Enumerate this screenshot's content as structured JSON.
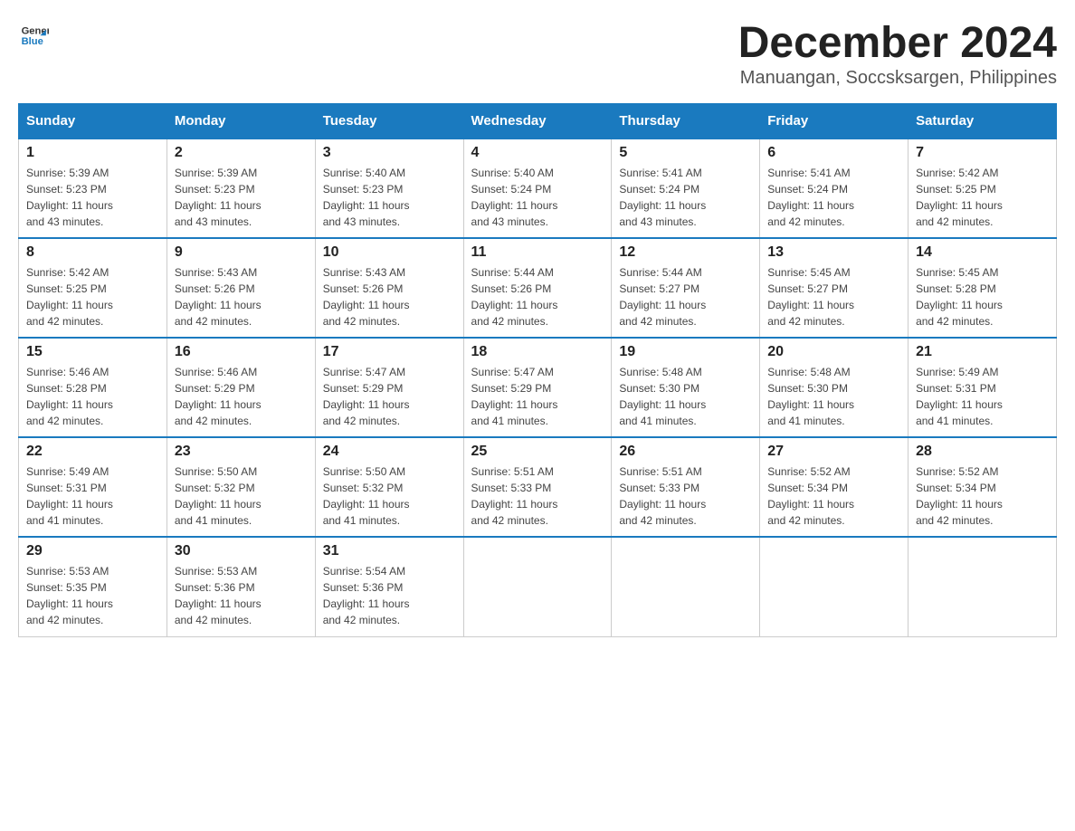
{
  "logo": {
    "text_general": "General",
    "text_blue": "Blue"
  },
  "title": "December 2024",
  "location": "Manuangan, Soccsksargen, Philippines",
  "weekdays": [
    "Sunday",
    "Monday",
    "Tuesday",
    "Wednesday",
    "Thursday",
    "Friday",
    "Saturday"
  ],
  "weeks": [
    [
      {
        "day": "1",
        "sunrise": "5:39 AM",
        "sunset": "5:23 PM",
        "daylight": "11 hours and 43 minutes."
      },
      {
        "day": "2",
        "sunrise": "5:39 AM",
        "sunset": "5:23 PM",
        "daylight": "11 hours and 43 minutes."
      },
      {
        "day": "3",
        "sunrise": "5:40 AM",
        "sunset": "5:23 PM",
        "daylight": "11 hours and 43 minutes."
      },
      {
        "day": "4",
        "sunrise": "5:40 AM",
        "sunset": "5:24 PM",
        "daylight": "11 hours and 43 minutes."
      },
      {
        "day": "5",
        "sunrise": "5:41 AM",
        "sunset": "5:24 PM",
        "daylight": "11 hours and 43 minutes."
      },
      {
        "day": "6",
        "sunrise": "5:41 AM",
        "sunset": "5:24 PM",
        "daylight": "11 hours and 42 minutes."
      },
      {
        "day": "7",
        "sunrise": "5:42 AM",
        "sunset": "5:25 PM",
        "daylight": "11 hours and 42 minutes."
      }
    ],
    [
      {
        "day": "8",
        "sunrise": "5:42 AM",
        "sunset": "5:25 PM",
        "daylight": "11 hours and 42 minutes."
      },
      {
        "day": "9",
        "sunrise": "5:43 AM",
        "sunset": "5:26 PM",
        "daylight": "11 hours and 42 minutes."
      },
      {
        "day": "10",
        "sunrise": "5:43 AM",
        "sunset": "5:26 PM",
        "daylight": "11 hours and 42 minutes."
      },
      {
        "day": "11",
        "sunrise": "5:44 AM",
        "sunset": "5:26 PM",
        "daylight": "11 hours and 42 minutes."
      },
      {
        "day": "12",
        "sunrise": "5:44 AM",
        "sunset": "5:27 PM",
        "daylight": "11 hours and 42 minutes."
      },
      {
        "day": "13",
        "sunrise": "5:45 AM",
        "sunset": "5:27 PM",
        "daylight": "11 hours and 42 minutes."
      },
      {
        "day": "14",
        "sunrise": "5:45 AM",
        "sunset": "5:28 PM",
        "daylight": "11 hours and 42 minutes."
      }
    ],
    [
      {
        "day": "15",
        "sunrise": "5:46 AM",
        "sunset": "5:28 PM",
        "daylight": "11 hours and 42 minutes."
      },
      {
        "day": "16",
        "sunrise": "5:46 AM",
        "sunset": "5:29 PM",
        "daylight": "11 hours and 42 minutes."
      },
      {
        "day": "17",
        "sunrise": "5:47 AM",
        "sunset": "5:29 PM",
        "daylight": "11 hours and 42 minutes."
      },
      {
        "day": "18",
        "sunrise": "5:47 AM",
        "sunset": "5:29 PM",
        "daylight": "11 hours and 41 minutes."
      },
      {
        "day": "19",
        "sunrise": "5:48 AM",
        "sunset": "5:30 PM",
        "daylight": "11 hours and 41 minutes."
      },
      {
        "day": "20",
        "sunrise": "5:48 AM",
        "sunset": "5:30 PM",
        "daylight": "11 hours and 41 minutes."
      },
      {
        "day": "21",
        "sunrise": "5:49 AM",
        "sunset": "5:31 PM",
        "daylight": "11 hours and 41 minutes."
      }
    ],
    [
      {
        "day": "22",
        "sunrise": "5:49 AM",
        "sunset": "5:31 PM",
        "daylight": "11 hours and 41 minutes."
      },
      {
        "day": "23",
        "sunrise": "5:50 AM",
        "sunset": "5:32 PM",
        "daylight": "11 hours and 41 minutes."
      },
      {
        "day": "24",
        "sunrise": "5:50 AM",
        "sunset": "5:32 PM",
        "daylight": "11 hours and 41 minutes."
      },
      {
        "day": "25",
        "sunrise": "5:51 AM",
        "sunset": "5:33 PM",
        "daylight": "11 hours and 42 minutes."
      },
      {
        "day": "26",
        "sunrise": "5:51 AM",
        "sunset": "5:33 PM",
        "daylight": "11 hours and 42 minutes."
      },
      {
        "day": "27",
        "sunrise": "5:52 AM",
        "sunset": "5:34 PM",
        "daylight": "11 hours and 42 minutes."
      },
      {
        "day": "28",
        "sunrise": "5:52 AM",
        "sunset": "5:34 PM",
        "daylight": "11 hours and 42 minutes."
      }
    ],
    [
      {
        "day": "29",
        "sunrise": "5:53 AM",
        "sunset": "5:35 PM",
        "daylight": "11 hours and 42 minutes."
      },
      {
        "day": "30",
        "sunrise": "5:53 AM",
        "sunset": "5:36 PM",
        "daylight": "11 hours and 42 minutes."
      },
      {
        "day": "31",
        "sunrise": "5:54 AM",
        "sunset": "5:36 PM",
        "daylight": "11 hours and 42 minutes."
      },
      null,
      null,
      null,
      null
    ]
  ],
  "labels": {
    "sunrise": "Sunrise:",
    "sunset": "Sunset:",
    "daylight": "Daylight:"
  }
}
